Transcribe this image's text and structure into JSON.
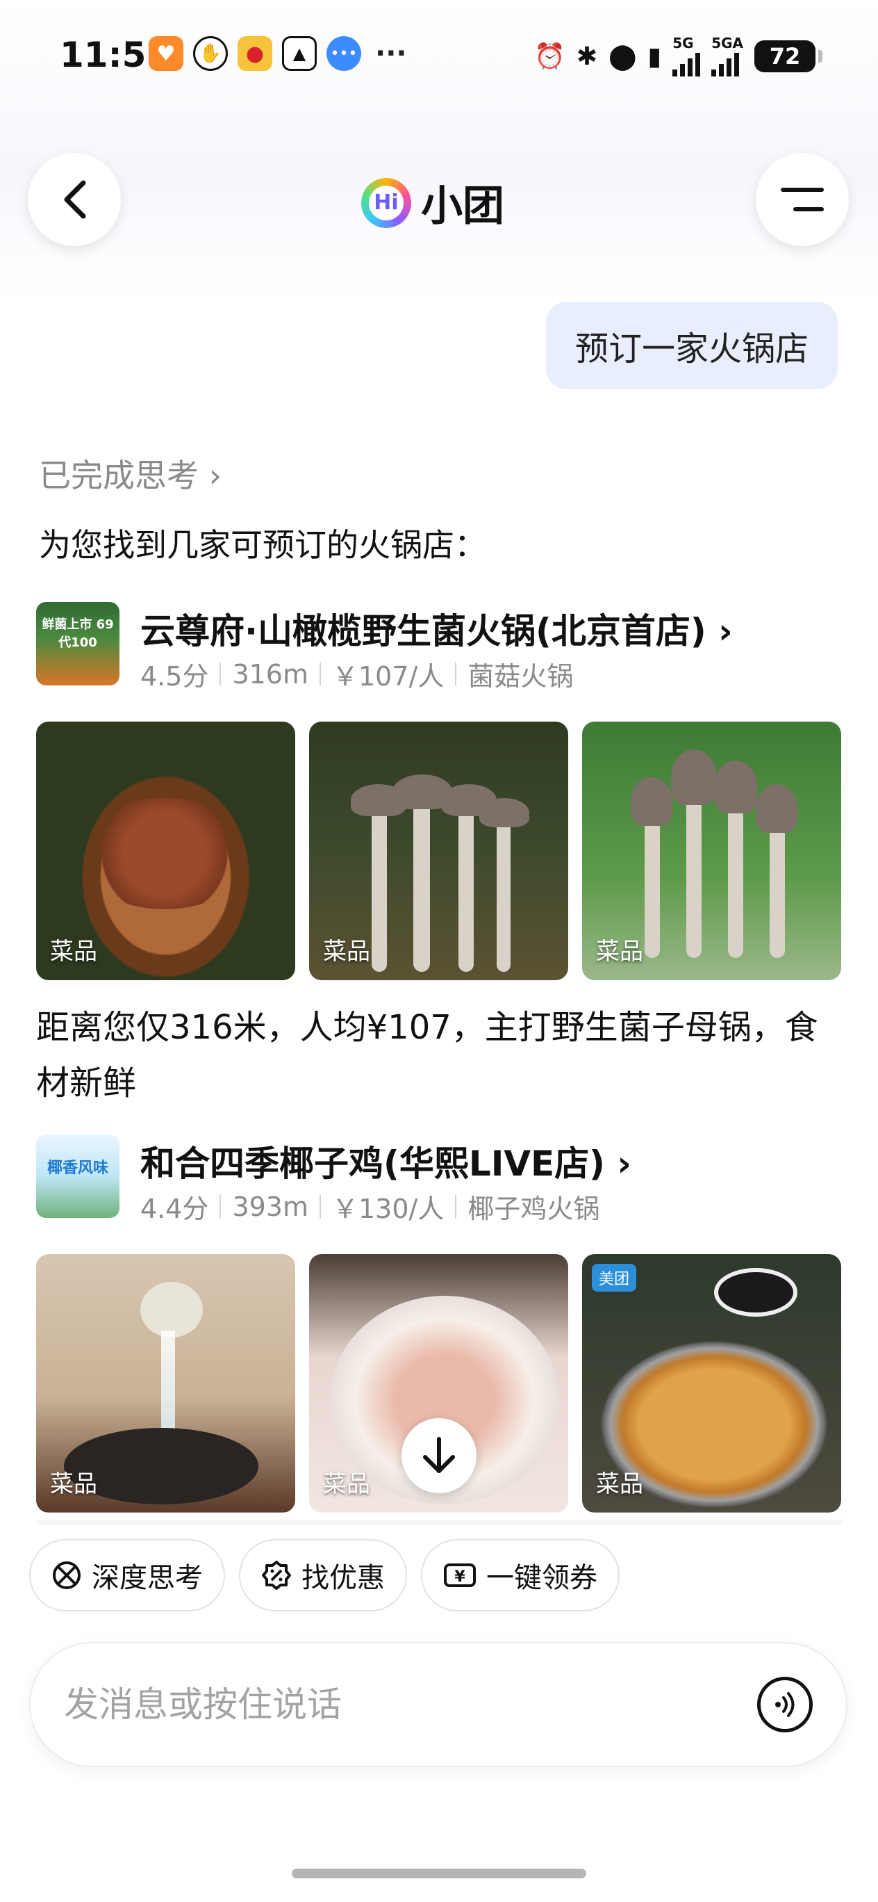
{
  "status_bar": {
    "time": "11:51",
    "more": "···",
    "net1": "5G",
    "net2": "5GA",
    "battery": "72"
  },
  "header": {
    "logo_text": "Hi",
    "title": "小团"
  },
  "chat": {
    "user_message": "预订一家火锅店",
    "thinking_label": "已完成思考 ›",
    "intro": "为您找到几家可预订的火锅店："
  },
  "restaurants": [
    {
      "name": "云尊府·山橄榄野生菌火锅(北京首店) ›",
      "rating": "4.5分",
      "distance": "316m",
      "price": "￥107/人",
      "category": "菌菇火锅",
      "logo_text": "鲜菌上市 69代100",
      "photo_tags": [
        "菜品",
        "菜品",
        "菜品"
      ],
      "description": "距离您仅316米，人均¥107，主打野生菌子母锅，食材新鲜"
    },
    {
      "name": "和合四季椰子鸡(华熙LIVE店) ›",
      "rating": "4.4分",
      "distance": "393m",
      "price": "￥130/人",
      "category": "椰子鸡火锅",
      "logo_text": "椰香风味",
      "photo_tags": [
        "菜品",
        "菜品",
        "菜品"
      ]
    }
  ],
  "chips": [
    {
      "label": "深度思考",
      "icon": "deep-think-icon"
    },
    {
      "label": "找优惠",
      "icon": "discount-icon"
    },
    {
      "label": "一键领券",
      "icon": "coupon-icon"
    }
  ],
  "input": {
    "placeholder": "发消息或按住说话"
  }
}
